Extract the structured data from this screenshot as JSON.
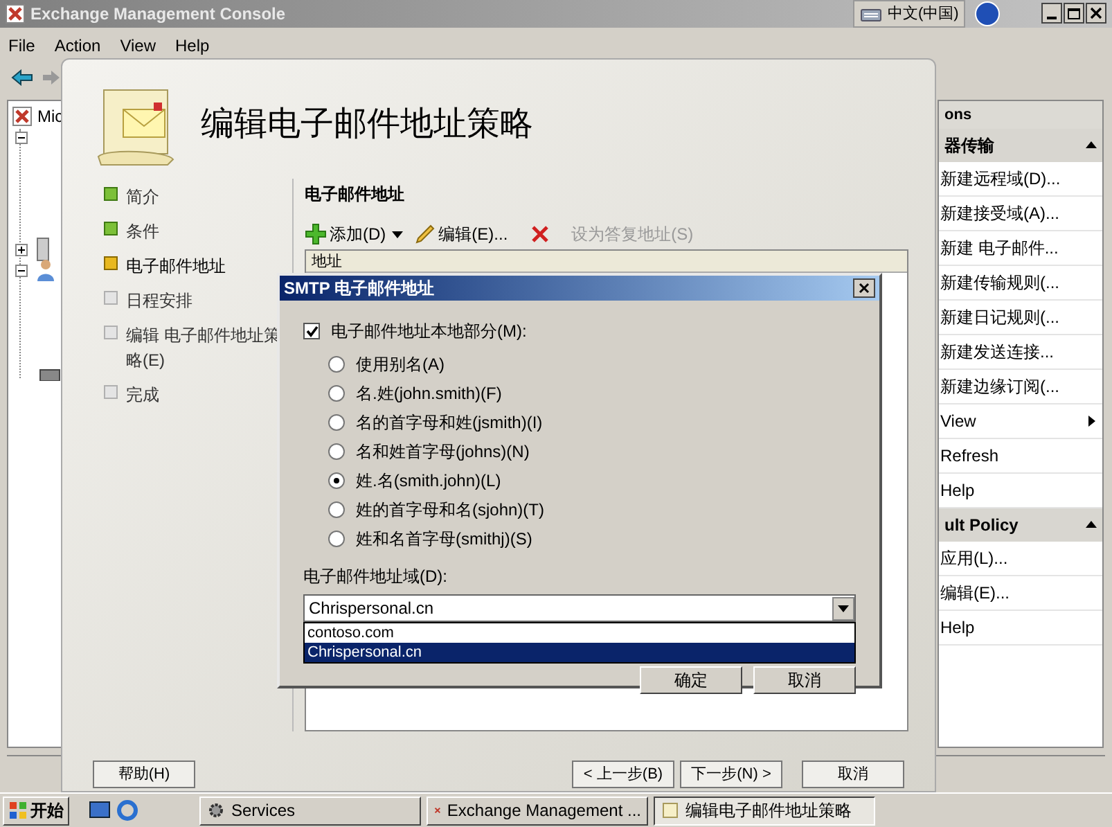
{
  "main_window": {
    "title": "Exchange Management Console",
    "menu": [
      "File",
      "Action",
      "View",
      "Help"
    ],
    "tree_root": "Mic",
    "actions": {
      "header": "ons",
      "sections": [
        {
          "title": "器传输",
          "expanded": true,
          "items": [
            {
              "label": "新建远程域(D)...",
              "submenu": false
            },
            {
              "label": "新建接受域(A)...",
              "submenu": false
            },
            {
              "label": "新建 电子邮件...",
              "submenu": false
            },
            {
              "label": "新建传输规则(...",
              "submenu": false
            },
            {
              "label": "新建日记规则(...",
              "submenu": false
            },
            {
              "label": "新建发送连接...",
              "submenu": false
            },
            {
              "label": "新建边缘订阅(...",
              "submenu": false
            },
            {
              "label": "View",
              "submenu": true
            },
            {
              "label": "Refresh",
              "submenu": false
            },
            {
              "label": "Help",
              "submenu": false
            }
          ]
        },
        {
          "title": "ult Policy",
          "expanded": true,
          "items": [
            {
              "label": "应用(L)...",
              "submenu": false
            },
            {
              "label": "编辑(E)...",
              "submenu": false
            },
            {
              "label": "Help",
              "submenu": false
            }
          ]
        }
      ]
    }
  },
  "language_bar": {
    "label": "中文(中国)"
  },
  "wizard": {
    "title": "编辑电子邮件地址策略",
    "steps": [
      {
        "label": "简介",
        "done": true,
        "current": false
      },
      {
        "label": "条件",
        "done": true,
        "current": false
      },
      {
        "label": "电子邮件地址",
        "done": false,
        "current": true
      },
      {
        "label": "日程安排",
        "done": false,
        "current": false
      },
      {
        "label": "编辑 电子邮件地址策略(E)",
        "done": false,
        "current": false
      },
      {
        "label": "完成",
        "done": false,
        "current": false
      }
    ],
    "section_title": "电子邮件地址",
    "toolbar": [
      {
        "kind": "add",
        "label": "添加(D)",
        "disabled": false
      },
      {
        "kind": "edit",
        "label": "编辑(E)...",
        "disabled": false
      },
      {
        "kind": "delete",
        "disabled": false
      },
      {
        "kind": "reply",
        "label": "设为答复地址(S)",
        "disabled": true
      }
    ],
    "list_columns": [
      "地址"
    ],
    "buttons": [
      "帮助(H)",
      "< 上一步(B)",
      "下一步(N) >",
      "取消"
    ]
  },
  "dialog": {
    "title": "SMTP 电子邮件地址",
    "local_part": {
      "label": "电子邮件地址本地部分(M):",
      "checked": true
    },
    "formats": [
      {
        "label": "使用别名(A)",
        "selected": false
      },
      {
        "label": "名.姓(john.smith)(F)",
        "selected": false
      },
      {
        "label": "名的首字母和姓(jsmith)(I)",
        "selected": false
      },
      {
        "label": "名和姓首字母(johns)(N)",
        "selected": false
      },
      {
        "label": "姓.名(smith.john)(L)",
        "selected": true
      },
      {
        "label": "姓的首字母和名(sjohn)(T)",
        "selected": false
      },
      {
        "label": "姓和名首字母(smithj)(S)",
        "selected": false
      }
    ],
    "domain_label": "电子邮件地址域(D):",
    "domain_value": "Chrispersonal.cn",
    "domain_options": [
      {
        "label": "contoso.com",
        "selected": false
      },
      {
        "label": "Chrispersonal.cn",
        "selected": true
      }
    ],
    "buttons": [
      "确定",
      "取消"
    ]
  },
  "taskbar": {
    "start": "开始",
    "tasks": [
      {
        "kind": "services",
        "label": "Services",
        "selected": false
      },
      {
        "kind": "exchange",
        "label": "Exchange Management ...",
        "selected": false
      },
      {
        "kind": "wizard",
        "label": "编辑电子邮件地址策略",
        "selected": true
      }
    ]
  }
}
